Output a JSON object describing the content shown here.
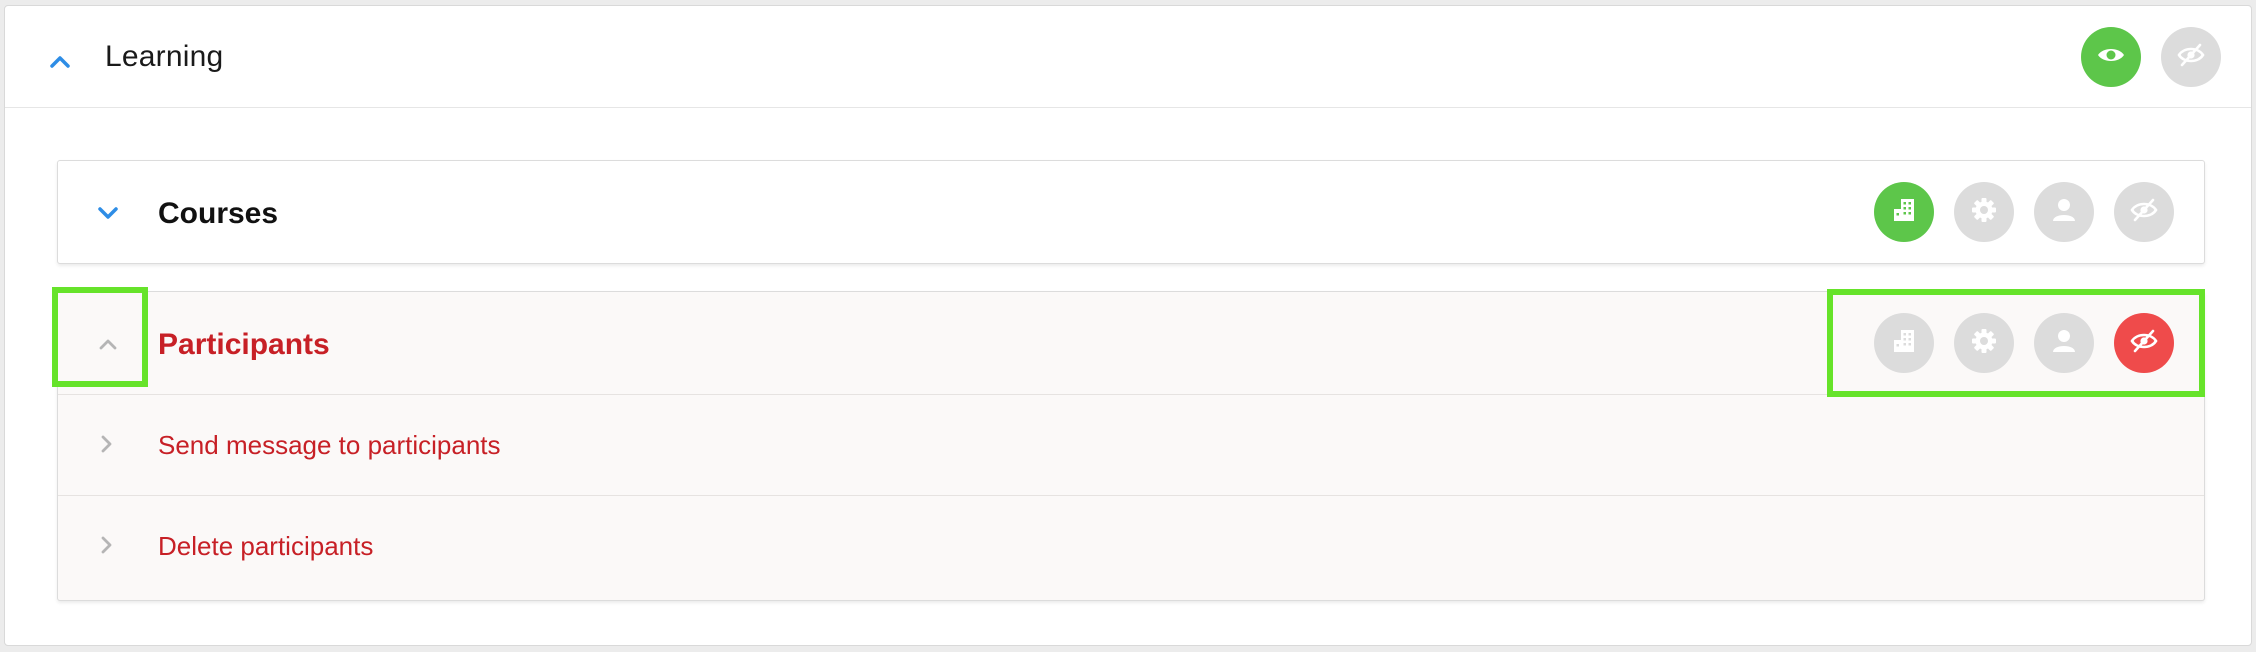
{
  "section": {
    "title": "Learning",
    "actions": [
      {
        "name": "visible-toggle",
        "icon": "eye-icon",
        "state": "active"
      },
      {
        "name": "hidden-toggle",
        "icon": "eye-slash-icon",
        "state": "inactive"
      }
    ]
  },
  "courses": {
    "title": "Courses",
    "actions": [
      {
        "icon": "building-icon",
        "state": "active"
      },
      {
        "icon": "gear-icon",
        "state": "inactive"
      },
      {
        "icon": "user-icon",
        "state": "inactive"
      },
      {
        "icon": "eye-slash-icon",
        "state": "inactive"
      }
    ]
  },
  "participants": {
    "title": "Participants",
    "actions": [
      {
        "icon": "building-icon",
        "state": "inactive"
      },
      {
        "icon": "gear-icon",
        "state": "inactive"
      },
      {
        "icon": "user-icon",
        "state": "inactive"
      },
      {
        "icon": "eye-slash-icon",
        "state": "danger"
      }
    ],
    "items": [
      {
        "label": "Send message to participants"
      },
      {
        "label": "Delete participants"
      }
    ]
  },
  "colors": {
    "accent_blue": "#2e8de6",
    "active_green": "#5dc64a",
    "danger_red": "#ef4b4b",
    "text_red": "#c72026",
    "highlight_green": "#66e32a"
  }
}
